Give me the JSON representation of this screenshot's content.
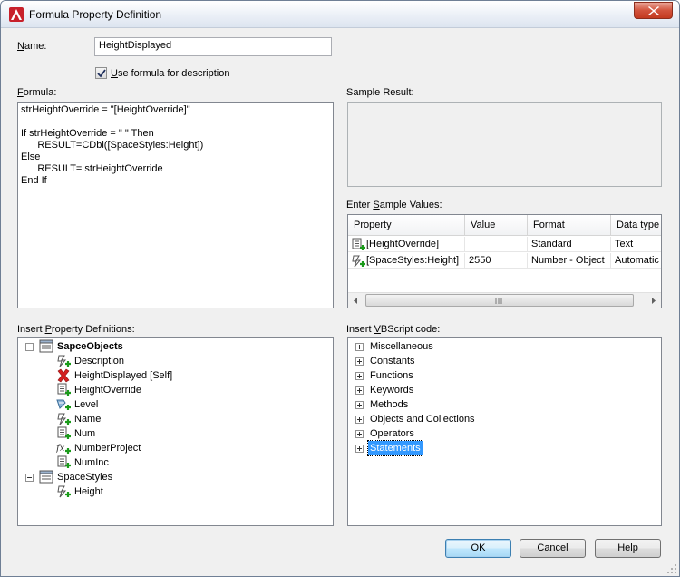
{
  "window": {
    "title": "Formula Property Definition"
  },
  "name_field": {
    "label": "Name:",
    "value": "HeightDisplayed"
  },
  "use_formula": {
    "label": "Use formula for description",
    "checked": true
  },
  "formula": {
    "label": "Formula:",
    "lines": [
      "strHeightOverride = \"[HeightOverride]\"",
      "",
      "If strHeightOverride = \" \" Then",
      "      RESULT=CDbl([SpaceStyles:Height])",
      "Else",
      "      RESULT= strHeightOverride",
      "End If"
    ]
  },
  "sample_result": {
    "label": "Sample Result:"
  },
  "sample_values": {
    "label": "Enter Sample Values:",
    "columns": [
      "Property",
      "Value",
      "Format",
      "Data type"
    ],
    "rows": [
      {
        "property": "[HeightOverride]",
        "value": "",
        "format": "Standard",
        "data_type": "Text",
        "icon": "property-add-icon"
      },
      {
        "property": "[SpaceStyles:Height]",
        "value": "2550",
        "format": "Number - Object",
        "data_type": "Automatic",
        "icon": "automatic-property-icon"
      }
    ]
  },
  "insert_props": {
    "label": "Insert Property Definitions:",
    "groups": [
      {
        "name": "SapceObjects",
        "items": [
          {
            "label": "Description",
            "icon": "automatic-property-icon"
          },
          {
            "label": "HeightDisplayed [Self]",
            "icon": "red-x-icon"
          },
          {
            "label": "HeightOverride",
            "icon": "property-add-icon"
          },
          {
            "label": "Level",
            "icon": "location-property-icon"
          },
          {
            "label": "Name",
            "icon": "automatic-property-icon"
          },
          {
            "label": "Num",
            "icon": "property-add-icon"
          },
          {
            "label": "NumberProject",
            "icon": "formula-icon"
          },
          {
            "label": "NumInc",
            "icon": "property-add-icon"
          }
        ]
      },
      {
        "name": "SpaceStyles",
        "items": [
          {
            "label": "Height",
            "icon": "automatic-property-icon"
          }
        ]
      }
    ]
  },
  "insert_vbscript": {
    "label": "Insert VBScript code:",
    "items": [
      "Miscellaneous",
      "Constants",
      "Functions",
      "Keywords",
      "Methods",
      "Objects and Collections",
      "Operators",
      "Statements"
    ],
    "selected": "Statements"
  },
  "buttons": {
    "ok": "OK",
    "cancel": "Cancel",
    "help": "Help"
  },
  "colors": {
    "selection": "#3399ff",
    "default_button_border": "#3c7fb1",
    "close": "#c33a20"
  }
}
